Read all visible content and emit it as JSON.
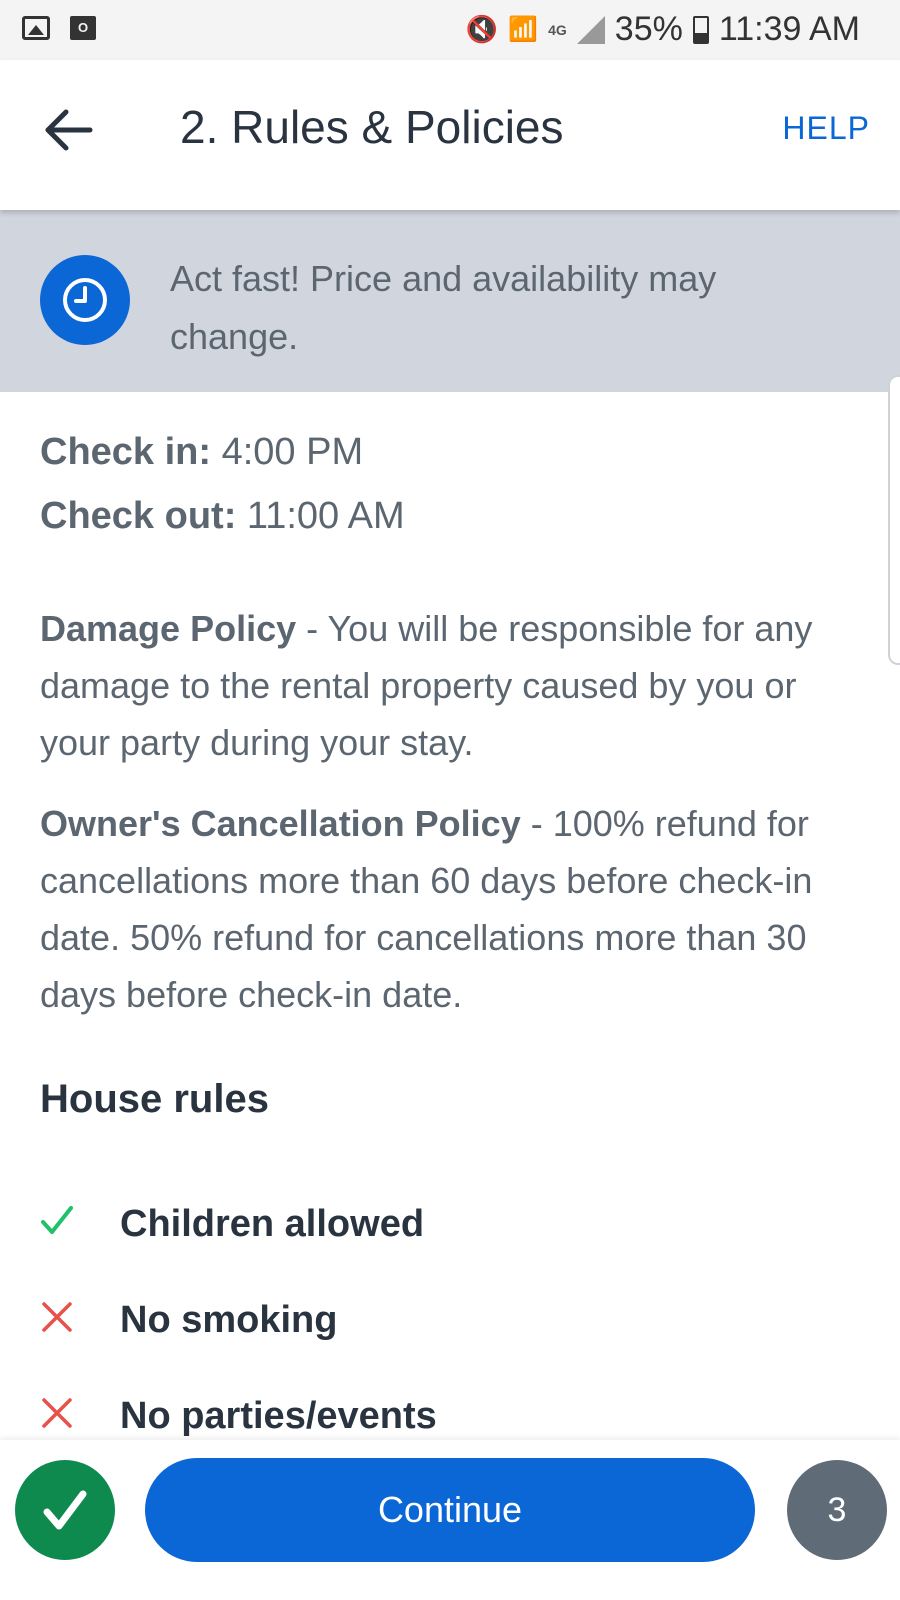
{
  "status_bar": {
    "lte": "4G",
    "battery": "35%",
    "time": "11:39 AM",
    "icons": [
      "gallery-icon",
      "outlook-icon",
      "mute-icon",
      "wifi-icon",
      "signal-icon",
      "battery-icon"
    ]
  },
  "header": {
    "title": "2. Rules & Policies",
    "help_label": "HELP",
    "back_icon": "arrow-left-icon"
  },
  "alert": {
    "icon": "clock-icon",
    "text": "Act fast! Price and availability may change."
  },
  "times": {
    "check_in_label": "Check in:",
    "check_in_value": "4:00 PM",
    "check_out_label": "Check out:",
    "check_out_value": "11:00 AM"
  },
  "policies": {
    "damage_title": "Damage Policy",
    "damage_text": " - You will be responsible for any damage to the rental property caused by you or your party during your stay.",
    "cancel_title": "Owner's Cancellation Policy",
    "cancel_text": " - 100% refund for cancellations more than 60 days before check-in date. 50% refund for cancellations more than 30 days before check-in date."
  },
  "house_rules": {
    "heading": "House rules",
    "items": [
      {
        "label": "Children allowed",
        "allowed": true,
        "icon": "check-icon"
      },
      {
        "label": "No smoking",
        "allowed": false,
        "icon": "x-icon"
      },
      {
        "label": "No parties/events",
        "allowed": false,
        "icon": "x-icon"
      }
    ]
  },
  "footer": {
    "continue_label": "Continue",
    "step_number": "3",
    "done_icon": "check-icon"
  },
  "colors": {
    "accent": "#0b66d6",
    "success": "#0f8a4f",
    "check_green": "#1fc16b",
    "cross_red": "#e8514a",
    "banner_bg": "#d1d6de"
  }
}
